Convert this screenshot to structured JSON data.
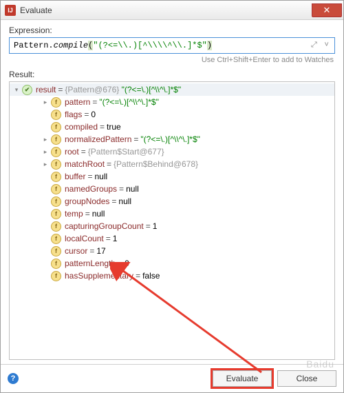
{
  "window": {
    "title": "Evaluate"
  },
  "labels": {
    "expression": "Expression:",
    "result": "Result:",
    "hint": "Use Ctrl+Shift+Enter to add to Watches"
  },
  "expression": {
    "class": "Pattern",
    "method": "compile",
    "arg": "\"(?<=\\\\.)[^\\\\\\\\^\\\\.]*$\""
  },
  "result": {
    "root": {
      "name": "result",
      "objref": "{Pattern@676}",
      "display": "\"(?<=\\.)[^\\\\^\\.]*$\""
    },
    "fields": [
      {
        "name": "pattern",
        "valueType": "str",
        "value": "\"(?<=\\.)[^\\\\^\\.]*$\"",
        "expandable": true
      },
      {
        "name": "flags",
        "valueType": "lit",
        "value": "0",
        "expandable": false
      },
      {
        "name": "compiled",
        "valueType": "lit",
        "value": "true",
        "expandable": false
      },
      {
        "name": "normalizedPattern",
        "valueType": "str",
        "value": "\"(?<=\\.)[^\\\\^\\.]*$\"",
        "expandable": true
      },
      {
        "name": "root",
        "valueType": "obj",
        "value": "{Pattern$Start@677}",
        "expandable": true
      },
      {
        "name": "matchRoot",
        "valueType": "obj",
        "value": "{Pattern$Behind@678}",
        "expandable": true
      },
      {
        "name": "buffer",
        "valueType": "lit",
        "value": "null",
        "expandable": false
      },
      {
        "name": "namedGroups",
        "valueType": "lit",
        "value": "null",
        "expandable": false
      },
      {
        "name": "groupNodes",
        "valueType": "lit",
        "value": "null",
        "expandable": false
      },
      {
        "name": "temp",
        "valueType": "lit",
        "value": "null",
        "expandable": false
      },
      {
        "name": "capturingGroupCount",
        "valueType": "lit",
        "value": "1",
        "expandable": false
      },
      {
        "name": "localCount",
        "valueType": "lit",
        "value": "1",
        "expandable": false
      },
      {
        "name": "cursor",
        "valueType": "lit",
        "value": "17",
        "expandable": false
      },
      {
        "name": "patternLength",
        "valueType": "lit",
        "value": "0",
        "expandable": false
      },
      {
        "name": "hasSupplementary",
        "valueType": "lit",
        "value": "false",
        "expandable": false
      }
    ]
  },
  "buttons": {
    "evaluate": "Evaluate",
    "close": "Close"
  },
  "watermark": "Baidu"
}
